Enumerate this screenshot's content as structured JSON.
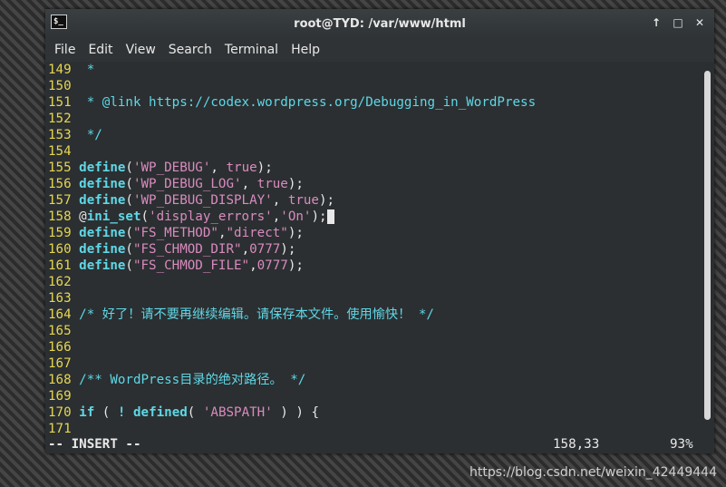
{
  "window": {
    "title": "root@TYD: /var/www/html",
    "icon": "terminal-icon",
    "controls": [
      "↑",
      "□",
      "✕"
    ]
  },
  "menu": [
    "File",
    "Edit",
    "View",
    "Search",
    "Terminal",
    "Help"
  ],
  "editor": {
    "lines": [
      {
        "n": "149",
        "parts": [
          {
            "t": " *",
            "c": "cmt"
          }
        ]
      },
      {
        "n": "150",
        "parts": []
      },
      {
        "n": "151",
        "parts": [
          {
            "t": " * @link https://codex.wordpress.org/Debugging_in_WordPress",
            "c": "cmt"
          }
        ]
      },
      {
        "n": "152",
        "parts": []
      },
      {
        "n": "153",
        "parts": [
          {
            "t": " */",
            "c": "cmt"
          }
        ]
      },
      {
        "n": "154",
        "parts": []
      },
      {
        "n": "155",
        "parts": [
          {
            "t": "define",
            "c": "kw"
          },
          {
            "t": "(",
            "c": "plain"
          },
          {
            "t": "'WP_DEBUG'",
            "c": "str"
          },
          {
            "t": ", ",
            "c": "plain"
          },
          {
            "t": "true",
            "c": "bool"
          },
          {
            "t": ");",
            "c": "plain"
          }
        ]
      },
      {
        "n": "156",
        "parts": [
          {
            "t": "define",
            "c": "kw"
          },
          {
            "t": "(",
            "c": "plain"
          },
          {
            "t": "'WP_DEBUG_LOG'",
            "c": "str"
          },
          {
            "t": ", ",
            "c": "plain"
          },
          {
            "t": "true",
            "c": "bool"
          },
          {
            "t": ");",
            "c": "plain"
          }
        ]
      },
      {
        "n": "157",
        "parts": [
          {
            "t": "define",
            "c": "kw"
          },
          {
            "t": "(",
            "c": "plain"
          },
          {
            "t": "'WP_DEBUG_DISPLAY'",
            "c": "str"
          },
          {
            "t": ", ",
            "c": "plain"
          },
          {
            "t": "true",
            "c": "bool"
          },
          {
            "t": ");",
            "c": "plain"
          }
        ]
      },
      {
        "n": "158",
        "parts": [
          {
            "t": "@",
            "c": "plain"
          },
          {
            "t": "ini_set",
            "c": "kw"
          },
          {
            "t": "(",
            "c": "plain"
          },
          {
            "t": "'display_errors'",
            "c": "str"
          },
          {
            "t": ",",
            "c": "plain"
          },
          {
            "t": "'On'",
            "c": "str"
          },
          {
            "t": ");",
            "c": "plain"
          },
          {
            "t": " ",
            "c": "cursor"
          }
        ]
      },
      {
        "n": "159",
        "parts": [
          {
            "t": "define",
            "c": "kw"
          },
          {
            "t": "(",
            "c": "plain"
          },
          {
            "t": "\"FS_METHOD\"",
            "c": "str"
          },
          {
            "t": ",",
            "c": "plain"
          },
          {
            "t": "\"direct\"",
            "c": "str"
          },
          {
            "t": ");",
            "c": "plain"
          }
        ]
      },
      {
        "n": "160",
        "parts": [
          {
            "t": "define",
            "c": "kw"
          },
          {
            "t": "(",
            "c": "plain"
          },
          {
            "t": "\"FS_CHMOD_DIR\"",
            "c": "str"
          },
          {
            "t": ",",
            "c": "plain"
          },
          {
            "t": "0777",
            "c": "str"
          },
          {
            "t": ");",
            "c": "plain"
          }
        ]
      },
      {
        "n": "161",
        "parts": [
          {
            "t": "define",
            "c": "kw"
          },
          {
            "t": "(",
            "c": "plain"
          },
          {
            "t": "\"FS_CHMOD_FILE\"",
            "c": "str"
          },
          {
            "t": ",",
            "c": "plain"
          },
          {
            "t": "0777",
            "c": "str"
          },
          {
            "t": ");",
            "c": "plain"
          }
        ]
      },
      {
        "n": "162",
        "parts": []
      },
      {
        "n": "163",
        "parts": []
      },
      {
        "n": "164",
        "parts": [
          {
            "t": "/* 好了！请不要再继续编辑。请保存本文件。使用愉快！ */",
            "c": "cmt"
          }
        ]
      },
      {
        "n": "165",
        "parts": []
      },
      {
        "n": "166",
        "parts": []
      },
      {
        "n": "167",
        "parts": []
      },
      {
        "n": "168",
        "parts": [
          {
            "t": "/** WordPress目录的绝对路径。 */",
            "c": "cmt"
          }
        ]
      },
      {
        "n": "169",
        "parts": []
      },
      {
        "n": "170",
        "parts": [
          {
            "t": "if",
            "c": "kw"
          },
          {
            "t": " ( ",
            "c": "plain"
          },
          {
            "t": "!",
            "c": "kw"
          },
          {
            "t": " ",
            "c": "plain"
          },
          {
            "t": "defined",
            "c": "kw"
          },
          {
            "t": "( ",
            "c": "plain"
          },
          {
            "t": "'ABSPATH'",
            "c": "str"
          },
          {
            "t": " ) ) {",
            "c": "plain"
          }
        ]
      },
      {
        "n": "171",
        "parts": []
      }
    ],
    "status": {
      "mode": "-- INSERT --",
      "position": "158,33",
      "percent": "93%"
    },
    "scroll_fraction": 0.93
  },
  "watermark": "https://blog.csdn.net/weixin_42449444"
}
